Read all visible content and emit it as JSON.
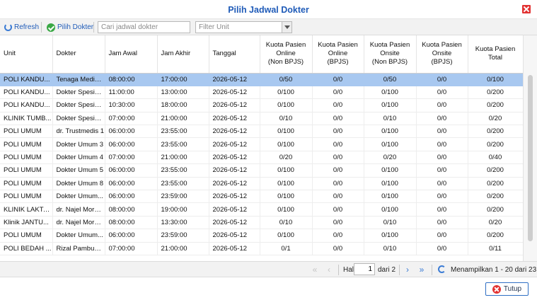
{
  "window": {
    "title": "Pilih Jadwal Dokter"
  },
  "toolbar": {
    "refresh_label": "Refresh",
    "pilih_label": "Pilih Dokter",
    "search_placeholder": "Cari jadwal dokter",
    "filter_placeholder": "Filter Unit"
  },
  "columns": {
    "unit": "Unit",
    "dokter": "Dokter",
    "jam_awal": "Jam Awal",
    "jam_akhir": "Jam Akhir",
    "tanggal": "Tanggal",
    "online_non_bpjs": [
      "Kuota Pasien",
      "Online",
      "(Non BPJS)"
    ],
    "online_bpjs": [
      "Kuota Pasien",
      "Online",
      "(BPJS)"
    ],
    "onsite_non_bpjs": [
      "Kuota Pasien",
      "Onsite",
      "(Non BPJS)"
    ],
    "onsite_bpjs": [
      "Kuota Pasien",
      "Onsite",
      "(BPJS)"
    ],
    "total": [
      "Kuota Pasien",
      "Total"
    ]
  },
  "rows": [
    [
      "POLI KANDU...",
      "Tenaga Medis ...",
      "08:00:00",
      "17:00:00",
      "2026-05-12",
      "0/50",
      "0/0",
      "0/50",
      "0/0",
      "0/100"
    ],
    [
      "POLI KANDU...",
      "Dokter Spesial...",
      "11:00:00",
      "13:00:00",
      "2026-05-12",
      "0/100",
      "0/0",
      "0/100",
      "0/0",
      "0/200"
    ],
    [
      "POLI KANDU...",
      "Dokter Spesial...",
      "10:30:00",
      "18:00:00",
      "2026-05-12",
      "0/100",
      "0/0",
      "0/100",
      "0/0",
      "0/200"
    ],
    [
      "KLINIK TUMB...",
      "Dokter Spesial...",
      "07:00:00",
      "21:00:00",
      "2026-05-12",
      "0/10",
      "0/0",
      "0/10",
      "0/0",
      "0/20"
    ],
    [
      "POLI UMUM",
      "dr. Trustmedis 1",
      "06:00:00",
      "23:55:00",
      "2026-05-12",
      "0/100",
      "0/0",
      "0/100",
      "0/0",
      "0/200"
    ],
    [
      "POLI UMUM",
      "Dokter Umum 3",
      "06:00:00",
      "23:55:00",
      "2026-05-12",
      "0/100",
      "0/0",
      "0/100",
      "0/0",
      "0/200"
    ],
    [
      "POLI UMUM",
      "Dokter Umum 4",
      "07:00:00",
      "21:00:00",
      "2026-05-12",
      "0/20",
      "0/0",
      "0/20",
      "0/0",
      "0/40"
    ],
    [
      "POLI UMUM",
      "Dokter Umum 5",
      "06:00:00",
      "23:55:00",
      "2026-05-12",
      "0/100",
      "0/0",
      "0/100",
      "0/0",
      "0/200"
    ],
    [
      "POLI UMUM",
      "Dokter Umum 8",
      "06:00:00",
      "23:55:00",
      "2026-05-12",
      "0/100",
      "0/0",
      "0/100",
      "0/0",
      "0/200"
    ],
    [
      "POLI UMUM",
      "Dokter Umum...",
      "06:00:00",
      "23:59:00",
      "2026-05-12",
      "0/100",
      "0/0",
      "0/100",
      "0/0",
      "0/200"
    ],
    [
      "KLINIK LAKTASI",
      "dr. Najel Mornov",
      "08:00:00",
      "19:00:00",
      "2026-05-12",
      "0/100",
      "0/0",
      "0/100",
      "0/0",
      "0/200"
    ],
    [
      "Klinik JANTU...",
      "dr. Najel Mornov",
      "08:00:00",
      "13:30:00",
      "2026-05-12",
      "0/10",
      "0/0",
      "0/10",
      "0/0",
      "0/20"
    ],
    [
      "POLI UMUM",
      "Dokter Umum...",
      "06:00:00",
      "23:59:00",
      "2026-05-12",
      "0/100",
      "0/0",
      "0/100",
      "0/0",
      "0/200"
    ],
    [
      "POLI BEDAH ...",
      "Rizal Pambudi,...",
      "07:00:00",
      "21:00:00",
      "2026-05-12",
      "0/1",
      "0/0",
      "0/10",
      "0/0",
      "0/11"
    ]
  ],
  "selected_row": 0,
  "pager": {
    "hal_label": "Hal",
    "page": "1",
    "of_label": "dari 2",
    "summary": "Menampilkan 1 - 20 dari 23"
  },
  "footer": {
    "close_label": "Tutup"
  },
  "colors": {
    "title": "#1f5bb8",
    "selected_row": "#a8c8f0",
    "close": "#e23232"
  }
}
